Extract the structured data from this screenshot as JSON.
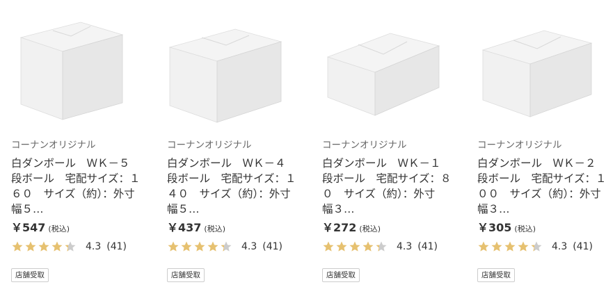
{
  "products": [
    {
      "brand": "コーナンオリジナル",
      "title": "白ダンボール　ＷＫ－５　段ボール　宅配サイズ：１６０　サイズ（約）：外寸　幅５…",
      "price": "￥547",
      "tax": "(税込)",
      "rating": "4.3",
      "count": "(41)",
      "rating_value": 4.3,
      "tag": "店舗受取",
      "image": "white-cardboard-box-tall-icon"
    },
    {
      "brand": "コーナンオリジナル",
      "title": "白ダンボール　ＷＫ－４　段ボール　宅配サイズ：１４０　サイズ（約）：外寸　幅５…",
      "price": "￥437",
      "tax": "(税込)",
      "rating": "4.3",
      "count": "(41)",
      "rating_value": 4.3,
      "tag": "店舗受取",
      "image": "white-cardboard-box-icon"
    },
    {
      "brand": "コーナンオリジナル",
      "title": "白ダンボール　ＷＫ－１　段ボール　宅配サイズ：８０　サイズ（約）：外寸　幅３…",
      "price": "￥272",
      "tax": "(税込)",
      "rating": "4.3",
      "count": "(41)",
      "rating_value": 4.3,
      "tag": "店舗受取",
      "image": "white-cardboard-box-flat-icon"
    },
    {
      "brand": "コーナンオリジナル",
      "title": "白ダンボール　ＷＫ－２　段ボール　宅配サイズ：１００　サイズ（約）：外寸　幅３…",
      "price": "￥305",
      "tax": "(税込)",
      "rating": "4.3",
      "count": "(41)",
      "rating_value": 4.3,
      "tag": "店舗受取",
      "image": "white-cardboard-box-icon"
    }
  ],
  "colors": {
    "star_filled": "#e6c170",
    "star_empty": "#cccccc",
    "text": "#333333",
    "brand_text": "#666666",
    "tag_border": "#cccccc"
  }
}
